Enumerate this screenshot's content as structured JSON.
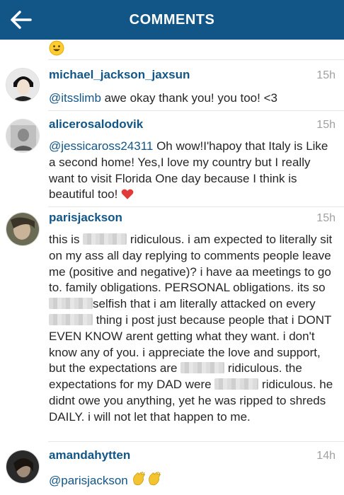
{
  "header": {
    "title": "COMMENTS"
  },
  "colors": {
    "header_bg": "#125688",
    "username": "#125688",
    "time": "#a0a0a0",
    "divider": "#e6e6e6"
  },
  "comments": [
    {
      "username": "michael_jackson_jaxsun",
      "time": "15h",
      "mention": "@itsslimb",
      "text": " awe okay thank you! you too! <3"
    },
    {
      "username": "alicerosalodovik",
      "time": "15h",
      "mention": "@jessicaross24311",
      "text": " Oh wow!I'hapoy that Italy is Like a second home! Yes,I love my country but I really want to visit Florida One day because I think is beautiful too!"
    },
    {
      "username": "parisjackson",
      "time": "15h",
      "parts": [
        "this is ",
        " ridiculous. i am expected to literally sit on my ass all day replying to comments people leave me (positive and negative)? i have aa meetings to go to. family obligations. PERSONAL obligations. its so ",
        "selfish that i am literally attacked on every ",
        " thing i post just because people that i DONT EVEN KNOW arent getting what they want. i don't know any of you. i appreciate the love and support, but the expectations are ",
        " ridiculous. the expectations for my DAD were ",
        " ridiculous. he didnt owe you anything, yet he was ripped to shreds DAILY. i will not let that happen to me."
      ]
    },
    {
      "username": "amandahytten",
      "time": "14h",
      "mention": "@parisjackson",
      "text": " "
    }
  ]
}
